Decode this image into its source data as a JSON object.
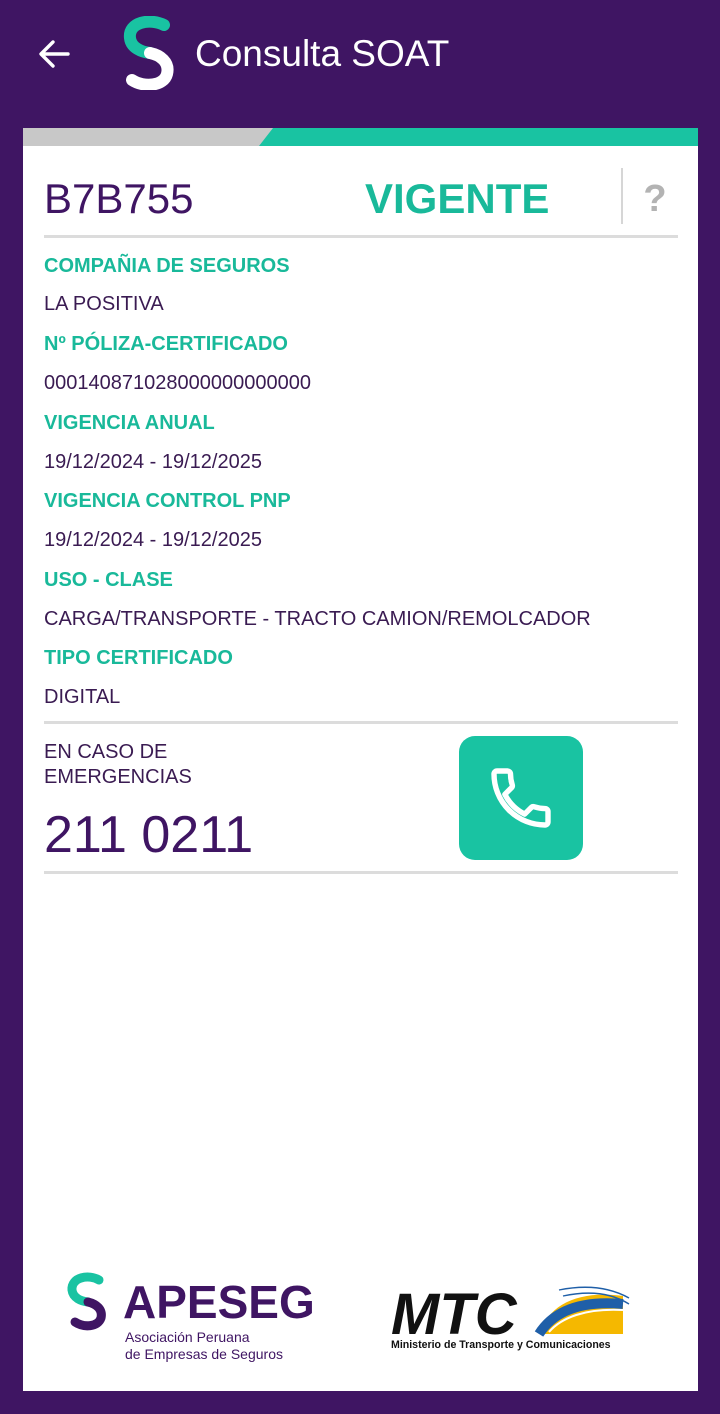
{
  "appbar": {
    "title": "Consulta SOAT",
    "back_icon": "arrow-left-icon",
    "logo": "soat-logo"
  },
  "colors": {
    "primary": "#3f1563",
    "accent": "#19b99a",
    "call_button": "#19c3a2",
    "progress_track": "#c8c8c8"
  },
  "progress": {
    "elapsed_fraction": 0.37
  },
  "record": {
    "plate": "B7B755",
    "status": "VIGENTE",
    "help": "?"
  },
  "fields": [
    {
      "label": "COMPAÑIA DE SEGUROS",
      "value": "LA POSITIVA"
    },
    {
      "label": "Nº PÓLIZA-CERTIFICADO",
      "value": "000140871028000000000000"
    },
    {
      "label": "VIGENCIA ANUAL",
      "value": "19/12/2024 - 19/12/2025"
    },
    {
      "label": "VIGENCIA CONTROL PNP",
      "value": "19/12/2024 - 19/12/2025"
    },
    {
      "label": "USO - CLASE",
      "value": "CARGA/TRANSPORTE - TRACTO CAMION/REMOLCADOR"
    },
    {
      "label": "TIPO CERTIFICADO",
      "value": "DIGITAL"
    }
  ],
  "emergency": {
    "label": "EN CASO DE EMERGENCIAS",
    "phone": "211 0211",
    "call_icon": "phone-icon"
  },
  "footer": {
    "apeseg": {
      "name": "APESEG",
      "subtitle_line1": "Asociación Peruana",
      "subtitle_line2": "de Empresas de Seguros"
    },
    "mtc": {
      "name": "MTC",
      "subtitle": "Ministerio de Transporte y Comunicaciones"
    }
  }
}
